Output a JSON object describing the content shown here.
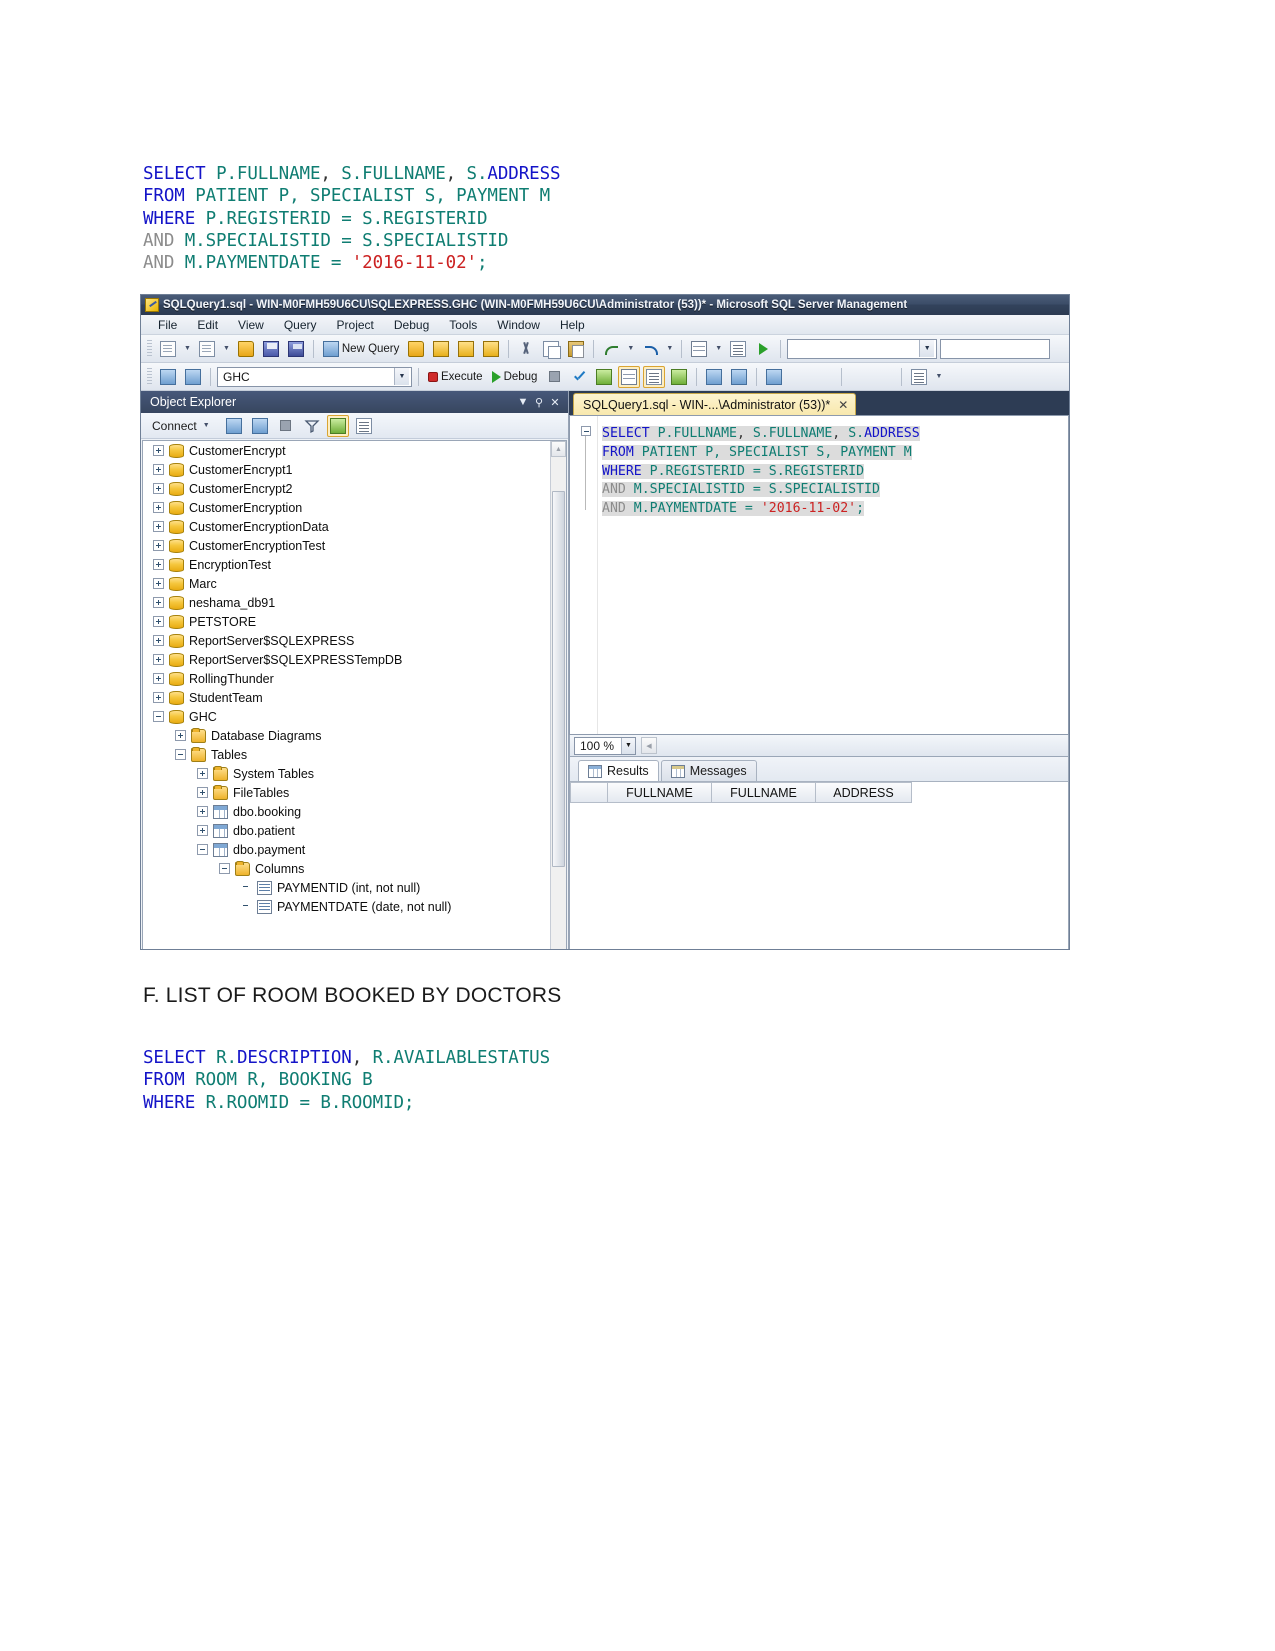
{
  "document": {
    "query_top": {
      "lines": [
        [
          {
            "t": "SELECT",
            "c": "kw"
          },
          {
            "t": " ",
            "c": "pun"
          },
          {
            "t": "P.FULLNAME",
            "c": "idn"
          },
          {
            "t": ", ",
            "c": "pun"
          },
          {
            "t": "S.FULLNAME",
            "c": "idn"
          },
          {
            "t": ", ",
            "c": "pun"
          },
          {
            "t": "S.",
            "c": "idn"
          },
          {
            "t": "ADDRESS",
            "c": "kw"
          }
        ],
        [
          {
            "t": "FROM",
            "c": "kw"
          },
          {
            "t": " ",
            "c": "pun"
          },
          {
            "t": "PATIENT P, SPECIALIST S, PAYMENT M",
            "c": "idn"
          }
        ],
        [
          {
            "t": "WHERE",
            "c": "kw"
          },
          {
            "t": " ",
            "c": "pun"
          },
          {
            "t": "P.REGISTERID = S.REGISTERID",
            "c": "idn"
          }
        ],
        [
          {
            "t": "AND",
            "c": "gry"
          },
          {
            "t": " ",
            "c": "pun"
          },
          {
            "t": "M.SPECIALISTID = S.SPECIALISTID",
            "c": "idn"
          }
        ],
        [
          {
            "t": "AND",
            "c": "gry"
          },
          {
            "t": " ",
            "c": "pun"
          },
          {
            "t": "M.PAYMENTDATE = ",
            "c": "idn"
          },
          {
            "t": "'2016-11-02'",
            "c": "str"
          },
          {
            "t": ";",
            "c": "idn"
          }
        ]
      ]
    },
    "section_heading": "F. LIST OF ROOM BOOKED BY DOCTORS",
    "query_bottom": {
      "lines": [
        [
          {
            "t": "SELECT",
            "c": "kw"
          },
          {
            "t": " ",
            "c": "pun"
          },
          {
            "t": "R.",
            "c": "idn"
          },
          {
            "t": "DESCRIPTION",
            "c": "kw"
          },
          {
            "t": ", ",
            "c": "pun"
          },
          {
            "t": "R.AVAILABLESTATUS",
            "c": "idn"
          }
        ],
        [
          {
            "t": "FROM",
            "c": "kw"
          },
          {
            "t": " ",
            "c": "pun"
          },
          {
            "t": "ROOM R, BOOKING B",
            "c": "idn"
          }
        ],
        [
          {
            "t": "WHERE",
            "c": "kw"
          },
          {
            "t": " ",
            "c": "pun"
          },
          {
            "t": "R.ROOMID = B.ROOMID",
            "c": "idn"
          },
          {
            "t": ";",
            "c": "idn"
          }
        ]
      ]
    }
  },
  "ssms": {
    "title": "SQLQuery1.sql - WIN-M0FMH59U6CU\\SQLEXPRESS.GHC (WIN-M0FMH59U6CU\\Administrator (53))* - Microsoft SQL Server Management",
    "menu": [
      "File",
      "Edit",
      "View",
      "Query",
      "Project",
      "Debug",
      "Tools",
      "Window",
      "Help"
    ],
    "toolbar1": {
      "new_query_label": "New Query",
      "icons": [
        "new-item-icon",
        "new-project-icon",
        "open-file-icon",
        "save-icon",
        "save-all-icon",
        "new-query-icon",
        "new-db-query-icon",
        "new-mdx-query-icon",
        "new-dmx-query-icon",
        "new-xmla-query-icon",
        "cut-icon",
        "copy-icon",
        "paste-icon",
        "undo-icon",
        "redo-icon",
        "find-icon",
        "launch-icon"
      ]
    },
    "toolbar2": {
      "database_combo_value": "GHC",
      "execute_label": "Execute",
      "debug_label": "Debug",
      "icons": [
        "connect-icon",
        "disconnect-icon",
        "stop-icon",
        "parse-icon",
        "display-estimated-plan-icon",
        "query-options-icon",
        "results-to-grid-icon",
        "results-to-text-icon",
        "results-to-file-icon",
        "include-actual-plan-icon",
        "include-client-stats-icon",
        "sqlcmd-mode-icon",
        "comment-icon",
        "uncomment-icon",
        "decrease-indent-icon",
        "increase-indent-icon",
        "specify-values-icon"
      ]
    },
    "object_explorer": {
      "title": "Object Explorer",
      "connect_label": "Connect",
      "toolbar_icons": [
        "connect-icon",
        "disconnect-icon",
        "stop-icon",
        "filter-icon",
        "refresh-icon",
        "unregister-icon"
      ],
      "tree": [
        {
          "label": "CustomerEncrypt",
          "indent": 0,
          "state": "plus",
          "icon": "database-icon"
        },
        {
          "label": "CustomerEncrypt1",
          "indent": 0,
          "state": "plus",
          "icon": "database-icon"
        },
        {
          "label": "CustomerEncrypt2",
          "indent": 0,
          "state": "plus",
          "icon": "database-icon"
        },
        {
          "label": "CustomerEncryption",
          "indent": 0,
          "state": "plus",
          "icon": "database-icon"
        },
        {
          "label": "CustomerEncryptionData",
          "indent": 0,
          "state": "plus",
          "icon": "database-icon"
        },
        {
          "label": "CustomerEncryptionTest",
          "indent": 0,
          "state": "plus",
          "icon": "database-icon"
        },
        {
          "label": "EncryptionTest",
          "indent": 0,
          "state": "plus",
          "icon": "database-icon"
        },
        {
          "label": "Marc",
          "indent": 0,
          "state": "plus",
          "icon": "database-icon"
        },
        {
          "label": "neshama_db91",
          "indent": 0,
          "state": "plus",
          "icon": "database-icon"
        },
        {
          "label": "PETSTORE",
          "indent": 0,
          "state": "plus",
          "icon": "database-icon"
        },
        {
          "label": "ReportServer$SQLEXPRESS",
          "indent": 0,
          "state": "plus",
          "icon": "database-icon"
        },
        {
          "label": "ReportServer$SQLEXPRESSTempDB",
          "indent": 0,
          "state": "plus",
          "icon": "database-icon"
        },
        {
          "label": "RollingThunder",
          "indent": 0,
          "state": "plus",
          "icon": "database-icon"
        },
        {
          "label": "StudentTeam",
          "indent": 0,
          "state": "plus",
          "icon": "database-icon"
        },
        {
          "label": "GHC",
          "indent": 0,
          "state": "minus",
          "icon": "database-icon"
        },
        {
          "label": "Database Diagrams",
          "indent": 1,
          "state": "plus",
          "icon": "folder-icon"
        },
        {
          "label": "Tables",
          "indent": 1,
          "state": "minus",
          "icon": "folder-icon"
        },
        {
          "label": "System Tables",
          "indent": 2,
          "state": "plus",
          "icon": "folder-icon"
        },
        {
          "label": "FileTables",
          "indent": 2,
          "state": "plus",
          "icon": "folder-icon"
        },
        {
          "label": "dbo.booking",
          "indent": 2,
          "state": "plus",
          "icon": "table-icon"
        },
        {
          "label": "dbo.patient",
          "indent": 2,
          "state": "plus",
          "icon": "table-icon"
        },
        {
          "label": "dbo.payment",
          "indent": 2,
          "state": "minus",
          "icon": "table-icon"
        },
        {
          "label": "Columns",
          "indent": 3,
          "state": "minus",
          "icon": "folder-icon"
        },
        {
          "label": "PAYMENTID (int, not null)",
          "indent": 4,
          "state": "none",
          "icon": "column-icon"
        },
        {
          "label": "PAYMENTDATE (date, not null)",
          "indent": 4,
          "state": "none",
          "icon": "column-icon"
        }
      ]
    },
    "query_tab": {
      "label": "SQLQuery1.sql - WIN-...\\Administrator (53))*",
      "close": "✕"
    },
    "editor": {
      "lines": [
        [
          {
            "t": "SELECT",
            "c": "kw"
          },
          {
            "t": " ",
            "c": "pun"
          },
          {
            "t": "P.FULLNAME",
            "c": "idn"
          },
          {
            "t": ", ",
            "c": "pun"
          },
          {
            "t": "S.FULLNAME",
            "c": "idn"
          },
          {
            "t": ", ",
            "c": "pun"
          },
          {
            "t": "S.",
            "c": "idn"
          },
          {
            "t": "ADDRESS",
            "c": "kw"
          }
        ],
        [
          {
            "t": "FROM",
            "c": "kw"
          },
          {
            "t": " ",
            "c": "pun"
          },
          {
            "t": "PATIENT P, SPECIALIST S, PAYMENT M",
            "c": "idn"
          }
        ],
        [
          {
            "t": "WHERE",
            "c": "kw"
          },
          {
            "t": " ",
            "c": "pun"
          },
          {
            "t": "P.REGISTERID = S.REGISTERID",
            "c": "idn"
          }
        ],
        [
          {
            "t": "AND",
            "c": "gry"
          },
          {
            "t": " ",
            "c": "pun"
          },
          {
            "t": "M.SPECIALISTID = S.SPECIALISTID",
            "c": "idn"
          }
        ],
        [
          {
            "t": "AND",
            "c": "gry"
          },
          {
            "t": " ",
            "c": "pun"
          },
          {
            "t": "M.PAYMENTDATE = ",
            "c": "idn"
          },
          {
            "t": "'2016-11-02'",
            "c": "str"
          },
          {
            "t": ";",
            "c": "idn"
          }
        ]
      ]
    },
    "zoom_bar": {
      "zoom_value": "100 %"
    },
    "results": {
      "tabs": [
        {
          "label": "Results",
          "icon": "grid-icon",
          "active": true
        },
        {
          "label": "Messages",
          "icon": "message-icon",
          "active": false
        }
      ],
      "columns": [
        "FULLNAME",
        "FULLNAME",
        "ADDRESS"
      ],
      "rows": []
    }
  },
  "colors": {
    "keyword": "#1414c8",
    "identifier": "#0f7d72",
    "string": "#cc2222",
    "comment_gray": "#8c8c8c",
    "titlebar": "#37465f",
    "tab_active": "#f8e8ad"
  }
}
